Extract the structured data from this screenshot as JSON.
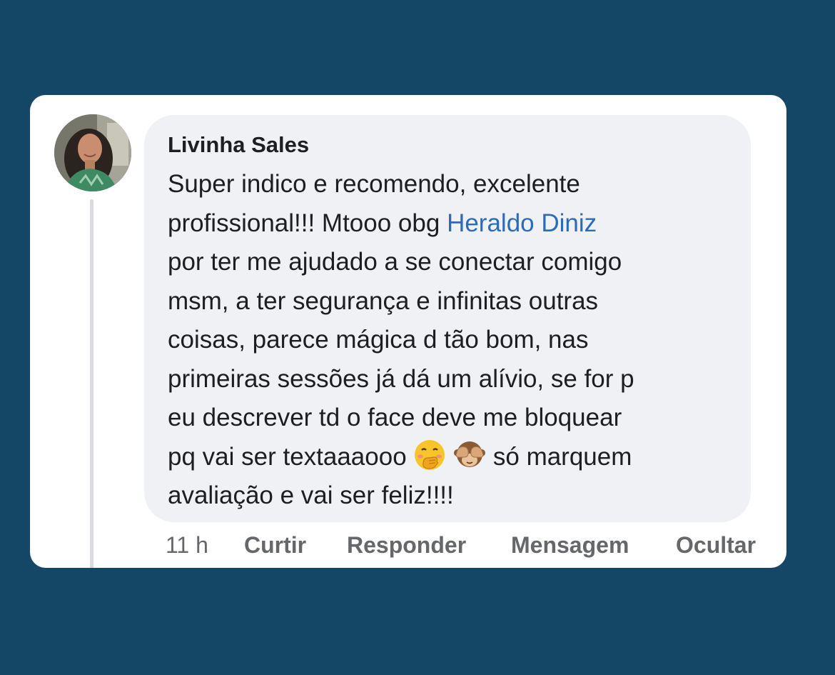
{
  "comment": {
    "author": "Livinha Sales",
    "lines": [
      [
        "Super indico e recomendo, excelente"
      ],
      [
        "profissional!!! Mtooo obg ",
        "Heraldo Diniz"
      ],
      [
        "por ter me ajudado a se conectar comigo"
      ],
      [
        "msm, a ter segurança e infinitas outras"
      ],
      [
        "coisas, parece mágica d tão bom, nas"
      ],
      [
        "primeiras sessões já dá um alívio, se for p"
      ],
      [
        "eu descrever td o face deve me bloquear"
      ],
      [
        "pq vai ser textaaaooo ",
        "só marquem"
      ],
      [
        "avaliação e vai ser feliz!!!!"
      ]
    ],
    "emojis": [
      "hand-over-mouth-emoji",
      "see-no-evil-monkey-emoji"
    ],
    "mention_color": "#2b6cb8"
  },
  "actions": {
    "time": "11 h",
    "like": "Curtir",
    "reply": "Responder",
    "message": "Mensagem",
    "hide": "Ocultar"
  },
  "colors": {
    "background": "#144766",
    "card": "#ffffff",
    "bubble": "#f0f1f5",
    "text": "#1c1e21",
    "secondary_text": "#65676b"
  }
}
